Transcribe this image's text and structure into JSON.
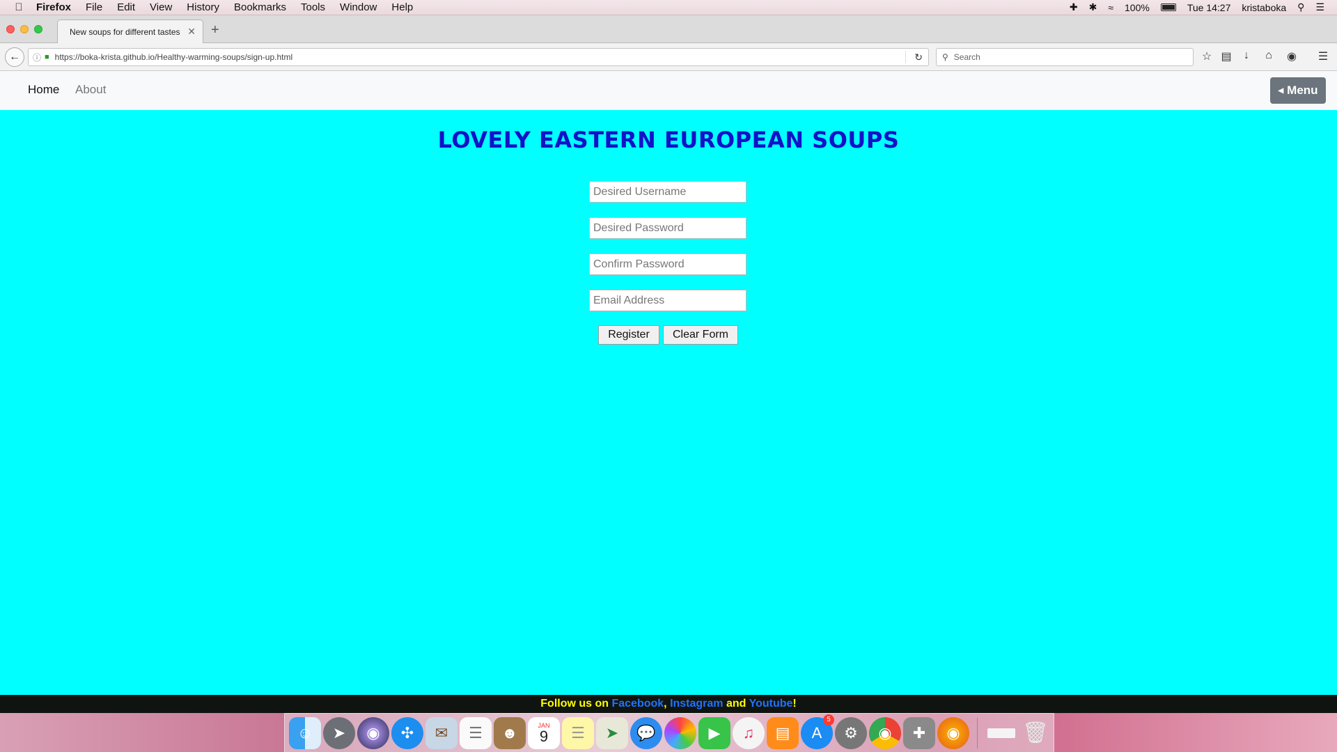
{
  "menubar": {
    "items": [
      "Firefox",
      "File",
      "Edit",
      "View",
      "History",
      "Bookmarks",
      "Tools",
      "Window",
      "Help"
    ],
    "battery": "100%",
    "clock": "Tue 14:27",
    "user": "kristaboka"
  },
  "browser": {
    "tab_title": "New soups for different tastes",
    "url": "https://boka-krista.github.io/Healthy-warming-soups/sign-up.html",
    "search_placeholder": "Search"
  },
  "site_nav": {
    "home": "Home",
    "about": "About",
    "menu": "Menu"
  },
  "page": {
    "title": "LOVELY EASTERN EUROPEAN SOUPS",
    "form": {
      "username_placeholder": "Desired Username",
      "password_placeholder": "Desired Password",
      "confirm_placeholder": "Confirm Password",
      "email_placeholder": "Email Address",
      "register_label": "Register",
      "clear_label": "Clear Form"
    }
  },
  "footer": {
    "prefix": "Follow us on ",
    "facebook": "Facebook",
    "comma": ", ",
    "instagram": "Instagram",
    "and": " and ",
    "youtube": "Youtube",
    "suffix": "!"
  },
  "dock": {
    "calendar_month": "JAN",
    "calendar_day": "9",
    "appstore_badge": "5"
  },
  "colors": {
    "page_bg": "#00ffff",
    "title": "#1212c8",
    "footer_yellow": "#ffff00",
    "footer_link": "#1e73ff",
    "menu_button": "#6c757d"
  }
}
